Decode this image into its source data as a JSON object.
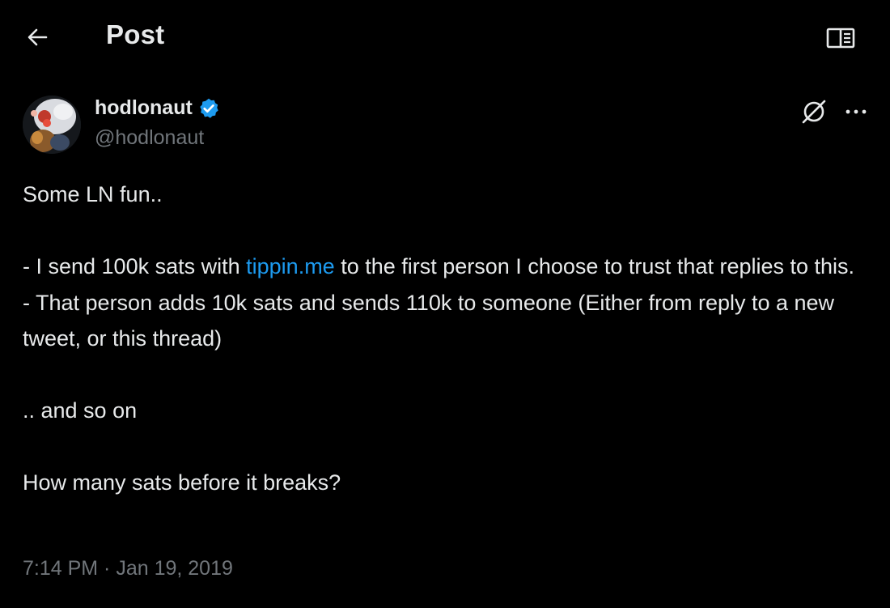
{
  "header": {
    "title": "Post",
    "back_icon": "arrow-left-icon",
    "reader_icon": "book-open-icon"
  },
  "author": {
    "display_name": "hodlonaut",
    "handle": "@hodlonaut",
    "verified_icon": "verified-badge-icon",
    "verified_color": "#1d9bf0",
    "grok_icon": "grok-icon",
    "more_icon": "more-horizontal-icon"
  },
  "tweet": {
    "line1": "Some LN fun..",
    "line2_prefix": "- I send 100k sats with ",
    "line2_link": "tippin.me",
    "line2_suffix": " to the first person I choose to trust that replies to this.",
    "line3": "- That person adds 10k sats and sends 110k to someone (Either from reply to a new tweet, or this thread)",
    "line4": ".. and so on",
    "line5": "How many sats before it breaks?",
    "link_color": "#1d9bf0"
  },
  "meta": {
    "timestamp": "7:14 PM · Jan 19, 2019"
  }
}
